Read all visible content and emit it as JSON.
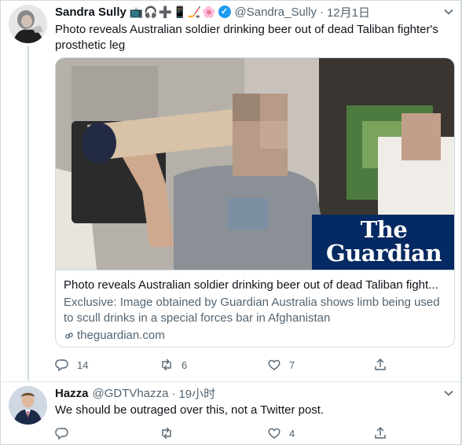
{
  "tweet": {
    "author_name": "Sandra Sully",
    "author_emoji": [
      "📺",
      "🎧",
      "➕",
      "📱",
      "🏒",
      "🌸"
    ],
    "handle": "@Sandra_Sully",
    "separator": "·",
    "time": "12月1日",
    "text": "Photo reveals Australian soldier drinking beer out of dead Taliban fighter's prosthetic leg",
    "card": {
      "logo_line1": "The",
      "logo_line2": "Guardian",
      "title": "Photo reveals Australian soldier drinking beer out of dead Taliban fight...",
      "description": "Exclusive: Image obtained by Guardian Australia shows limb being used to scull drinks in a special forces bar in Afghanistan",
      "domain": "theguardian.com"
    },
    "actions": {
      "reply_count": "14",
      "retweet_count": "6",
      "like_count": "7"
    }
  },
  "reply": {
    "author_name": "Hazza",
    "handle": "@GDTVhazza",
    "separator": "·",
    "time": "19小时",
    "text": "We should be outraged over this, not a Twitter post.",
    "actions": {
      "reply_count": "",
      "retweet_count": "",
      "like_count": "4"
    }
  },
  "colors": {
    "text_primary": "#0f1419",
    "text_secondary": "#536471",
    "verified_blue": "#1d9bf0",
    "guardian_navy": "#052962",
    "border": "#cfd9de"
  },
  "icons": {
    "verified": "verified-badge-icon",
    "caret": "chevron-down-icon",
    "reply": "reply-icon",
    "retweet": "retweet-icon",
    "like": "heart-icon",
    "share": "share-icon",
    "link": "link-icon"
  }
}
